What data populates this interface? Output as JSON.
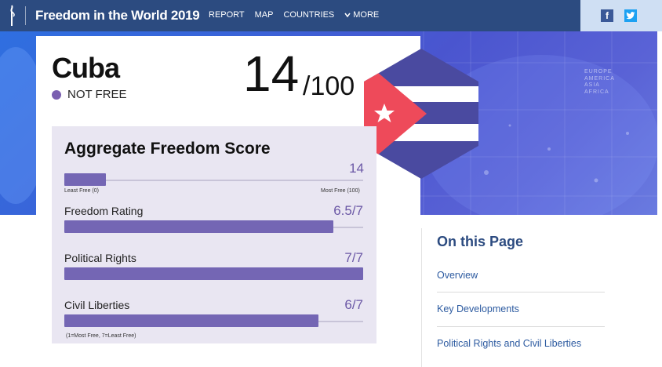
{
  "header": {
    "site_title": "Freedom in the World 2019",
    "nav": [
      {
        "label": "REPORT"
      },
      {
        "label": "MAP"
      },
      {
        "label": "COUNTRIES"
      },
      {
        "label": "MORE"
      }
    ],
    "social": {
      "facebook": "f",
      "twitter": "t"
    }
  },
  "hero": {
    "region_words": [
      "EUROPE",
      "AMERICA",
      "ASIA",
      "AFRICA"
    ]
  },
  "country": {
    "name": "Cuba",
    "status": "NOT FREE",
    "status_color": "#7a5fb0",
    "score": "14",
    "score_max": "/100"
  },
  "aggregate": {
    "title": "Aggregate Freedom Score",
    "value": "14",
    "fraction": 0.14,
    "min_label": "Least Free (0)",
    "max_label": "Most Free (100)"
  },
  "metrics": [
    {
      "label": "Freedom Rating",
      "value": "6.5/7",
      "fraction": 0.9
    },
    {
      "label": "Political Rights",
      "value": "7/7",
      "fraction": 1.0
    },
    {
      "label": "Civil Liberties",
      "value": "6/7",
      "fraction": 0.85
    }
  ],
  "metrics_footnote": "(1=Most Free, 7=Least Free)",
  "sidebar": {
    "title": "On this Page",
    "links": [
      "Overview",
      "Key Developments",
      "Political Rights and Civil Liberties"
    ]
  },
  "colors": {
    "navbar": "#2c4b80",
    "accent_purple": "#7466b4",
    "flag_blue": "#4a4aa0",
    "flag_red": "#ee4a5a"
  },
  "icons": [
    "freedom-house-logo-icon",
    "chevron-down-icon",
    "facebook-icon",
    "twitter-icon",
    "star-icon"
  ]
}
